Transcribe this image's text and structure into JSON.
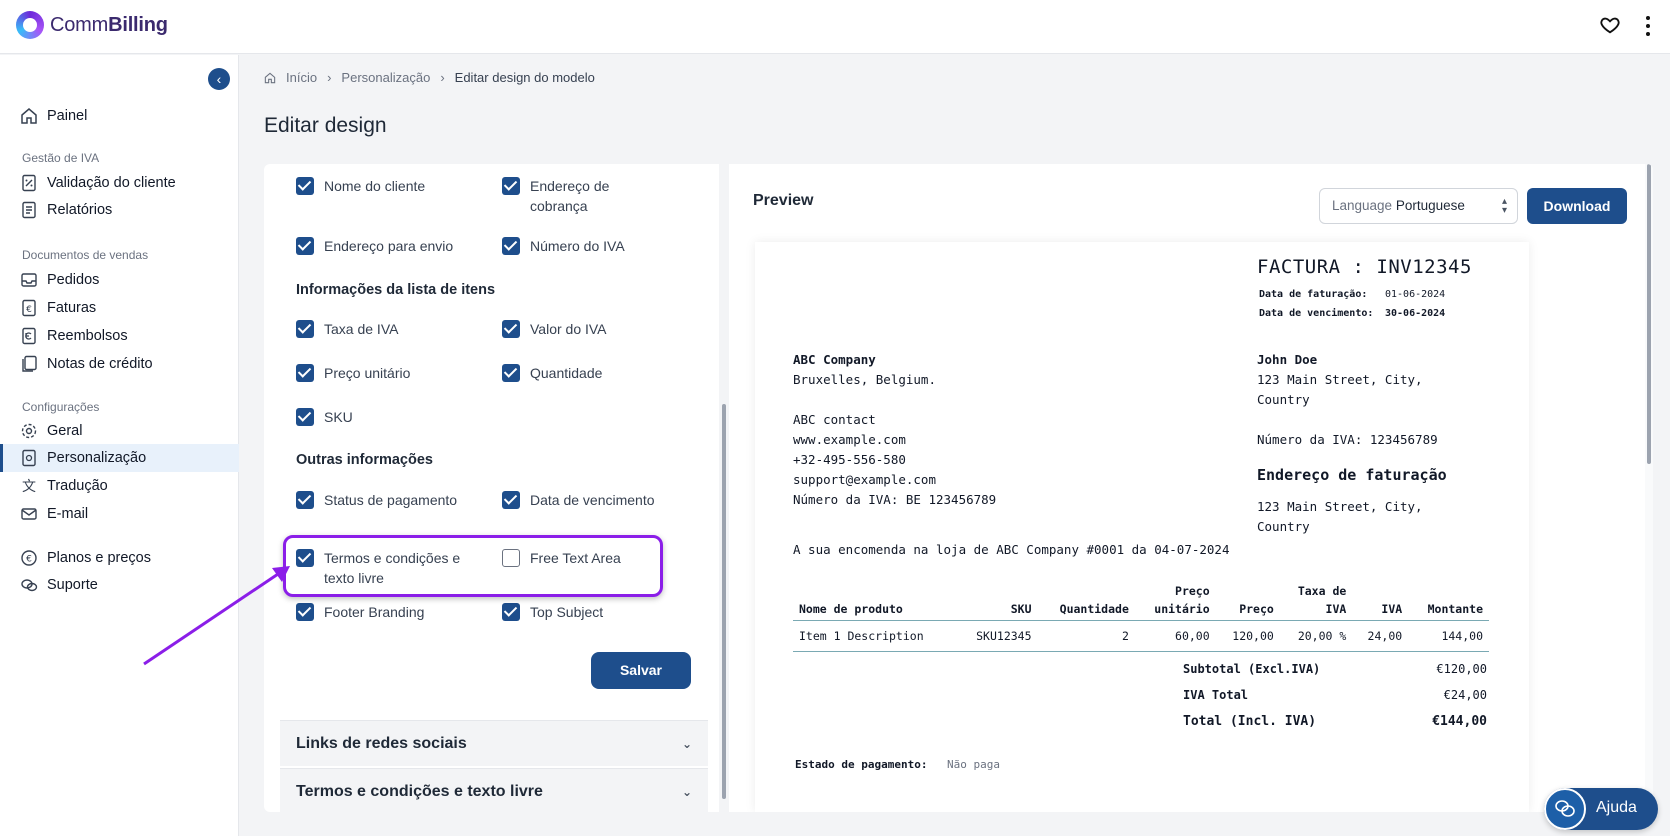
{
  "app": {
    "brand_light": "Comm",
    "brand_bold": "Billing",
    "accent": "#1e4e8c"
  },
  "topbar": {
    "favorite_icon": "heart-icon",
    "menu_icon": "kebab-icon"
  },
  "sidebar": {
    "collapse_icon": "chevron-left-icon",
    "dashboard": "Painel",
    "section_vat": "Gestão de IVA",
    "client_validation": "Validação do cliente",
    "reports": "Relatórios",
    "section_sales": "Documentos de vendas",
    "orders": "Pedidos",
    "invoices": "Faturas",
    "refunds": "Reembolsos",
    "credit_notes": "Notas de crédito",
    "section_settings": "Configurações",
    "general": "Geral",
    "personalization": "Personalização",
    "translation": "Tradução",
    "email": "E-mail",
    "plans": "Planos e preços",
    "support": "Suporte"
  },
  "breadcrumb": {
    "home": "Início",
    "personalization": "Personalização",
    "current": "Editar design do modelo"
  },
  "page_title": "Editar design",
  "settings": {
    "customer_name": "Nome do cliente",
    "billing_address_1": "Endereço de",
    "billing_address_2": "cobrança",
    "shipping_address": "Endereço para envio",
    "vat_number": "Número do IVA",
    "items_section": "Informações da lista de itens",
    "vat_rate": "Taxa de IVA",
    "vat_value": "Valor do IVA",
    "unit_price": "Preço unitário",
    "quantity": "Quantidade",
    "sku": "SKU",
    "other_section": "Outras informações",
    "payment_status": "Status de pagamento",
    "due_date": "Data de vencimento",
    "terms_1": "Termos e condições e",
    "terms_2": "texto livre",
    "free_text": "Free Text Area",
    "free_text_checked": false,
    "footer_branding": "Footer Branding",
    "top_subject": "Top Subject",
    "save": "Salvar",
    "social_links": "Links de redes sociais",
    "terms_accordion": "Termos e condições e texto livre",
    "highlight_color": "#8b1ee8"
  },
  "preview": {
    "label": "Preview",
    "language_label": "Language",
    "language_value": "Portuguese",
    "download": "Download"
  },
  "invoice": {
    "title": "FACTURA : INV12345",
    "invoice_date_label": "Data de faturação:",
    "invoice_date": "01-06-2024",
    "due_date_label": "Data de vencimento:",
    "due_date": "30-06-2024",
    "seller_name": "ABC Company",
    "seller_city": "Bruxelles, Belgium.",
    "seller_contact": "ABC contact",
    "seller_web": "www.example.com",
    "seller_phone": "+32-495-556-580",
    "seller_email": "support@example.com",
    "seller_vat": "Número da IVA: BE 123456789",
    "buyer_name": "John Doe",
    "buyer_addr_1": "123 Main Street, City,",
    "buyer_addr_2": "Country",
    "buyer_vat": "Número da IVA: 123456789",
    "billing_heading": "Endereço de faturação",
    "billing_addr_1": "123 Main Street, City,",
    "billing_addr_2": "Country",
    "order_note": "A sua encomenda na loja de ABC Company #0001 da 04-07-2024",
    "columns": [
      "Nome de produto",
      "SKU",
      "Quantidade",
      "Preço unitário",
      "Preço",
      "Taxa de IVA",
      "IVA",
      "Montante"
    ],
    "col_unit_1": "Preço",
    "col_unit_2": "unitário",
    "col_rate_1": "Taxa de",
    "col_rate_2": "IVA",
    "row": [
      "Item 1 Description",
      "SKU12345",
      "2",
      "60,00",
      "120,00",
      "20,00 %",
      "24,00",
      "144,00"
    ],
    "subtotal_label": "Subtotal (Excl.IVA)",
    "subtotal": "€120,00",
    "vat_total_label": "IVA Total",
    "vat_total": "€24,00",
    "total_label": "Total (Incl. IVA)",
    "total": "€144,00",
    "payment_label": "Estado de pagamento:",
    "payment_value": "Não paga"
  },
  "help": {
    "label": "Ajuda",
    "icon": "chat-icon"
  }
}
